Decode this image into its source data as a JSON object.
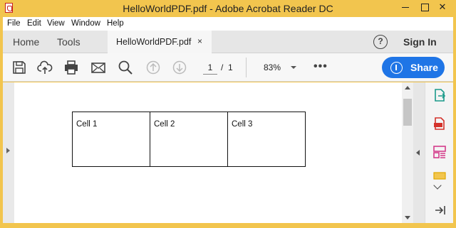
{
  "window": {
    "title": "HelloWorldPDF.pdf - Adobe Acrobat Reader DC"
  },
  "menu": {
    "items": [
      "File",
      "Edit",
      "View",
      "Window",
      "Help"
    ]
  },
  "tabs": {
    "home": "Home",
    "tools": "Tools",
    "document": "HelloWorldPDF.pdf",
    "close_glyph": "×",
    "sign_in": "Sign In",
    "help_glyph": "?"
  },
  "toolbar": {
    "current_page": "1",
    "page_separator": "/",
    "total_pages": "1",
    "zoom": "83%",
    "more_glyph": "•••",
    "share_label": "Share",
    "icons": [
      "save-icon",
      "upload-cloud-icon",
      "print-icon",
      "email-icon",
      "search-icon",
      "page-up-icon",
      "page-down-icon"
    ]
  },
  "document": {
    "table": {
      "cells": [
        "Cell 1",
        "Cell 2",
        "Cell 3"
      ]
    }
  },
  "right_pane": {
    "icons": [
      "export-pdf-icon",
      "create-pdf-icon",
      "organize-pages-icon",
      "comment-icon",
      "collapse-pane-icon"
    ]
  },
  "colors": {
    "title_bar": "#f2c54e",
    "share_button": "#1f75e6",
    "adobe_red": "#c8201b"
  }
}
